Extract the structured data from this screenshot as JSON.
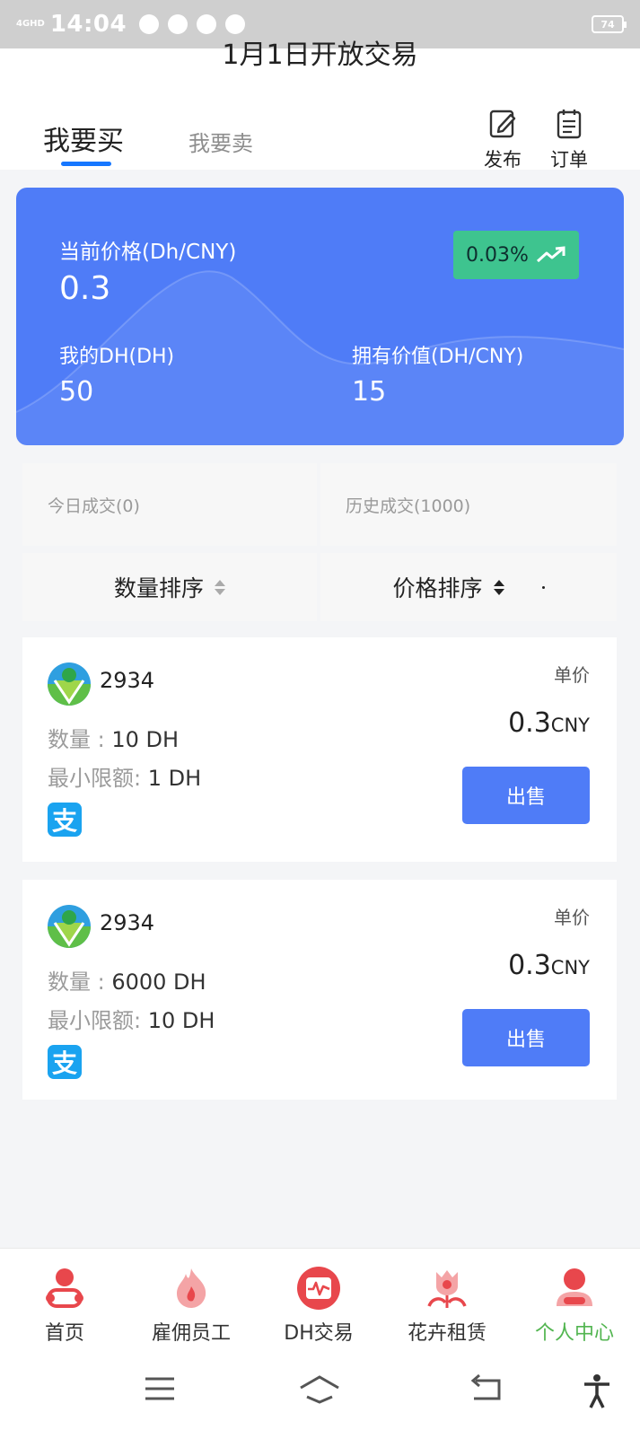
{
  "status_bar": {
    "network": "4GHD",
    "time": "14:04",
    "battery": "74"
  },
  "header": {
    "clipped_title": "1月1日开放交易",
    "tabs": {
      "buy": "我要买",
      "sell": "我要卖"
    },
    "actions": {
      "publish": "发布",
      "orders": "订单"
    }
  },
  "price_card": {
    "price_label": "当前价格(Dh/CNY)",
    "price_value": "0.3",
    "change": "0.03%",
    "my_dh_label": "我的DH(DH)",
    "my_dh_value": "50",
    "worth_label": "拥有价值(DH/CNY)",
    "worth_value": "15"
  },
  "stats": {
    "today": "今日成交(0)",
    "history": "历史成交(1000)"
  },
  "sort": {
    "quantity": "数量排序",
    "price": "价格排序"
  },
  "listings": [
    {
      "seller": "2934",
      "qty_key": "数量 : ",
      "qty_value": "10 DH",
      "min_key": "最小限额: ",
      "min_value": "1 DH",
      "pay_icon_char": "支",
      "unit_label": "单价",
      "unit_price": "0.3",
      "currency": "CNY",
      "button": "出售"
    },
    {
      "seller": "2934",
      "qty_key": "数量 : ",
      "qty_value": "6000 DH",
      "min_key": "最小限额: ",
      "min_value": "10 DH",
      "pay_icon_char": "支",
      "unit_label": "单价",
      "unit_price": "0.3",
      "currency": "CNY",
      "button": "出售"
    }
  ],
  "bottom_nav": [
    {
      "label": "首页",
      "icon": "home-icon"
    },
    {
      "label": "雇佣员工",
      "icon": "flame-icon"
    },
    {
      "label": "DH交易",
      "icon": "trade-icon"
    },
    {
      "label": "花卉租赁",
      "icon": "flower-icon"
    },
    {
      "label": "个人中心",
      "icon": "user-icon",
      "active": true
    }
  ],
  "colors": {
    "accent": "#4f7cf7",
    "up": "#3ec48f",
    "active_nav": "#52b550",
    "nav_icon": "#e8474c"
  }
}
